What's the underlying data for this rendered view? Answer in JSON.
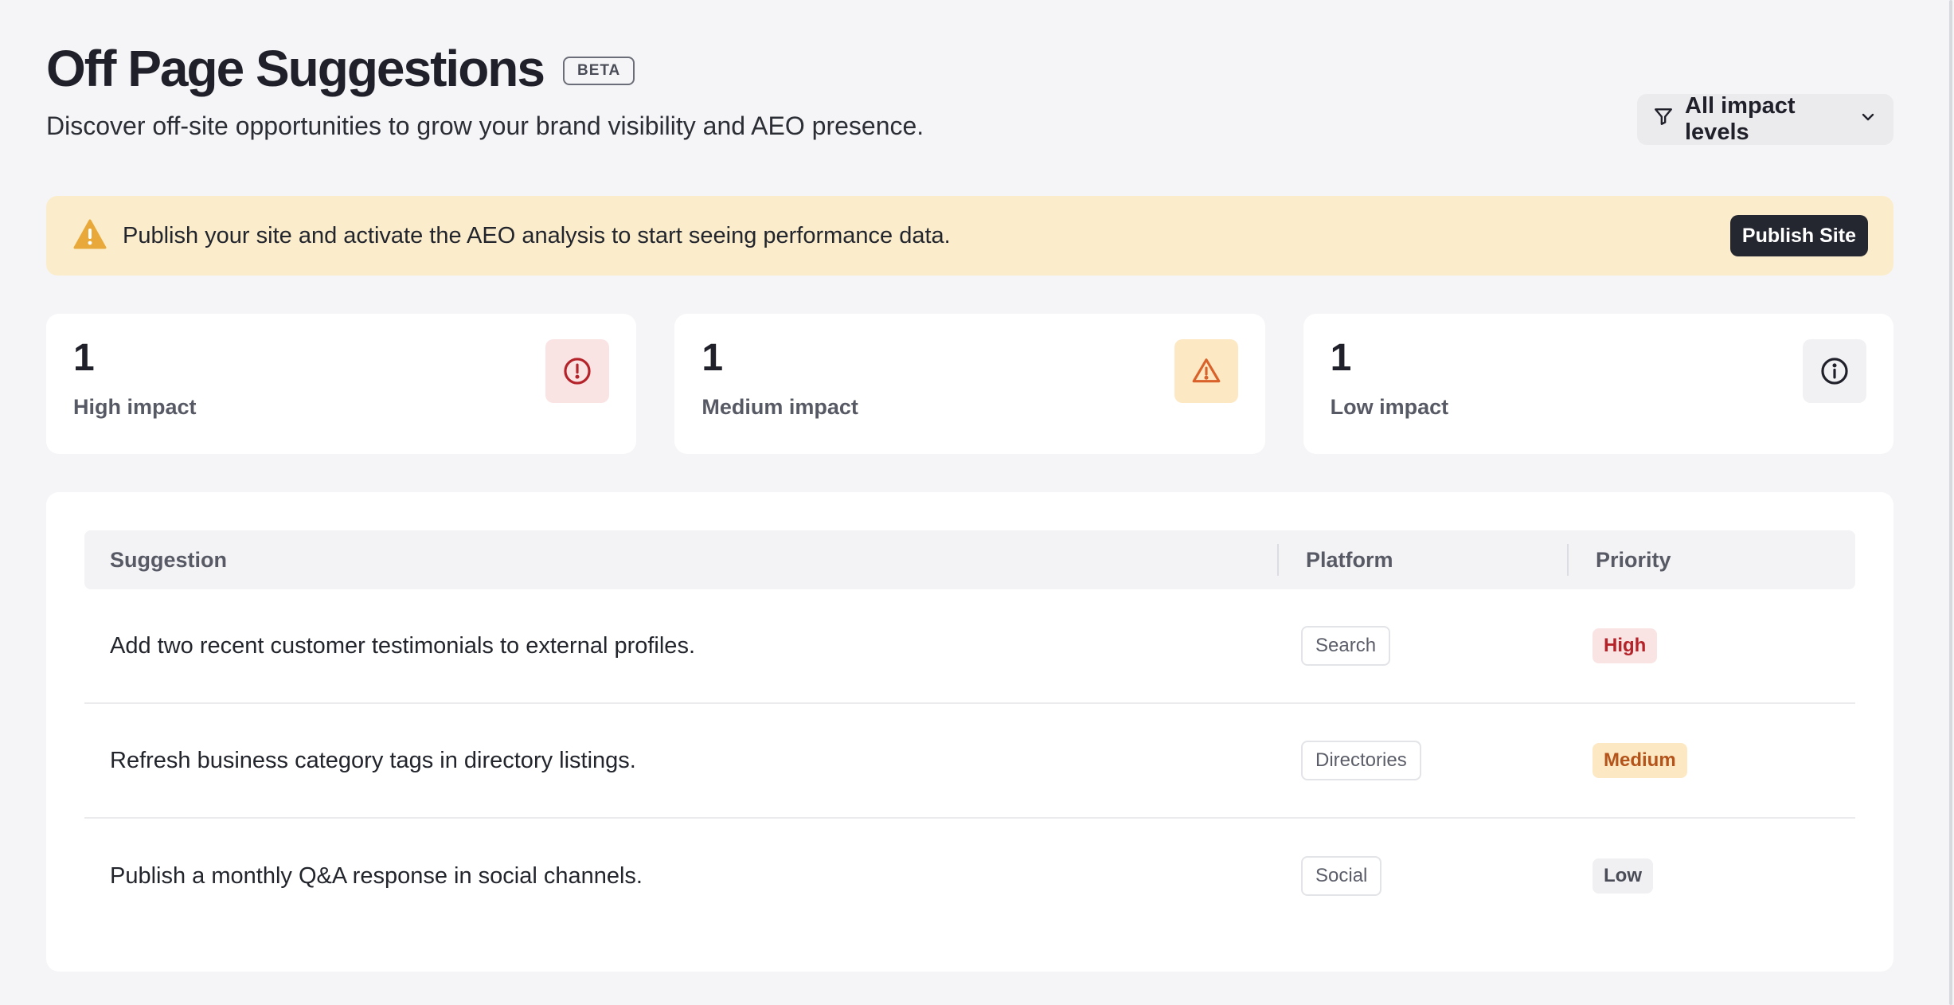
{
  "header": {
    "title": "Off Page Suggestions",
    "badge": "BETA",
    "subtitle": "Discover off-site opportunities to grow your brand visibility and AEO presence.",
    "filter_label": "All impact levels",
    "filter_icon": "funnel-icon",
    "filter_caret_icon": "chevron-down-icon"
  },
  "banner": {
    "icon": "warning-triangle-icon",
    "message": "Publish your site and activate the AEO analysis to start seeing performance data.",
    "button_label": "Publish Site"
  },
  "stats": [
    {
      "count": "1",
      "label": "High impact",
      "icon": "alert-circle-icon",
      "color": "#b4232a"
    },
    {
      "count": "1",
      "label": "Medium impact",
      "icon": "alert-triangle-icon",
      "color": "#d9622b"
    },
    {
      "count": "1",
      "label": "Low impact",
      "icon": "info-circle-icon",
      "color": "#1f2029"
    }
  ],
  "table": {
    "columns": [
      "Suggestion",
      "Platform",
      "Priority"
    ],
    "rows": [
      {
        "suggestion": "Add two recent customer testimonials to external profiles.",
        "platform": "Search",
        "priority": "High"
      },
      {
        "suggestion": "Refresh business category tags in directory listings.",
        "platform": "Directories",
        "priority": "Medium"
      },
      {
        "suggestion": "Publish a monthly Q&A response in social channels.",
        "platform": "Social",
        "priority": "Low"
      }
    ]
  },
  "colors": {
    "background": "#f5f5f7",
    "banner_bg": "#fbedcc",
    "warning_accent": "#e8a93a",
    "dark_button": "#242630"
  }
}
